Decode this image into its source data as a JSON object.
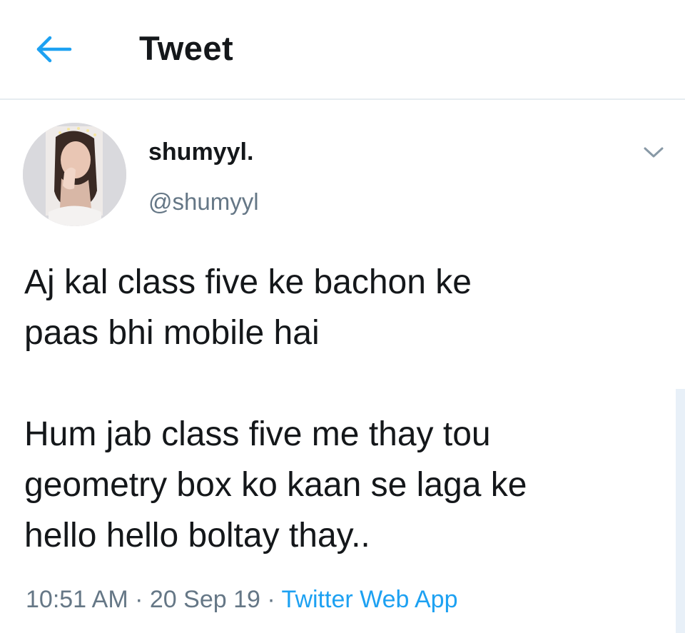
{
  "header": {
    "title": "Tweet",
    "back_icon": "arrow-left-icon"
  },
  "author": {
    "display_name": "shumyyl.",
    "handle": "@shumyyl"
  },
  "tweet": {
    "lines_paragraph_1": [
      "Aj kal class five ke bachon ke",
      "paas bhi mobile hai"
    ],
    "lines_paragraph_2": [
      "Hum jab class five me thay tou",
      "geometry box ko kaan se laga ke",
      "hello hello boltay thay.."
    ]
  },
  "meta": {
    "time": "10:51 AM",
    "separator": "·",
    "date": "20 Sep 19",
    "source": "Twitter Web App"
  },
  "colors": {
    "accent": "#1da1f2",
    "secondary_text": "#657786",
    "primary_text": "#14171a",
    "divider": "#e6ecf0"
  }
}
